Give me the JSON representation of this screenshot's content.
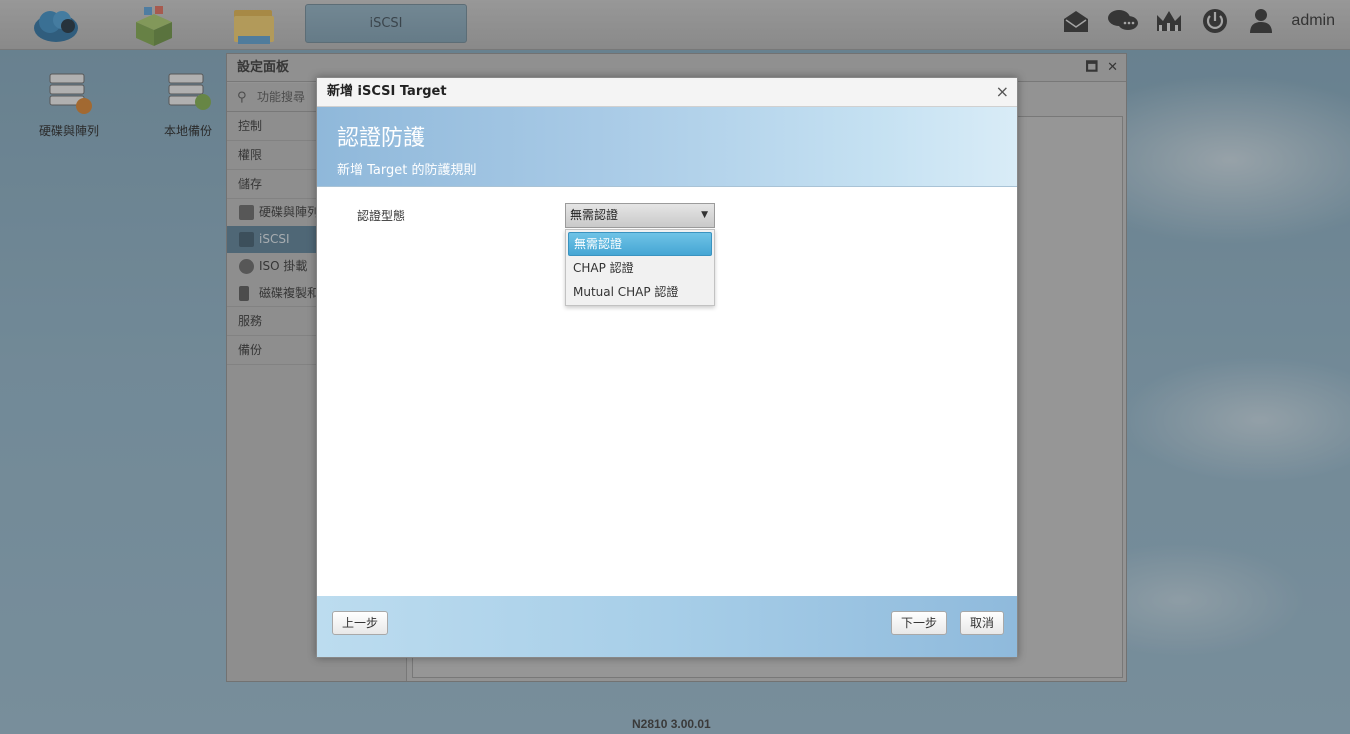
{
  "taskbar": {
    "active_tab": "iSCSI",
    "user": "admin"
  },
  "desktop": {
    "icons": [
      "硬碟與陣列",
      "本地備份"
    ]
  },
  "settings_panel": {
    "title": "設定面板",
    "search_placeholder": "功能搜尋",
    "nav": {
      "control": "控制",
      "privilege": "權限",
      "storage": "儲存",
      "disk_raid": "硬碟與陣列",
      "iscsi": "iSCSI",
      "iso_mount": "ISO 掛載",
      "disk_clone": "磁碟複製和",
      "service": "服務",
      "backup": "備份"
    }
  },
  "dialog": {
    "title": "新增 iSCSI Target",
    "header_title": "認證防護",
    "header_subtitle": "新增 Target 的防護規則",
    "auth_label": "認證型態",
    "auth_selected": "無需認證",
    "auth_options": [
      "無需認證",
      "CHAP 認證",
      "Mutual CHAP 認證"
    ],
    "buttons": {
      "prev": "上一步",
      "next": "下一步",
      "cancel": "取消"
    }
  },
  "footer": {
    "version": "N2810   3.00.01"
  }
}
